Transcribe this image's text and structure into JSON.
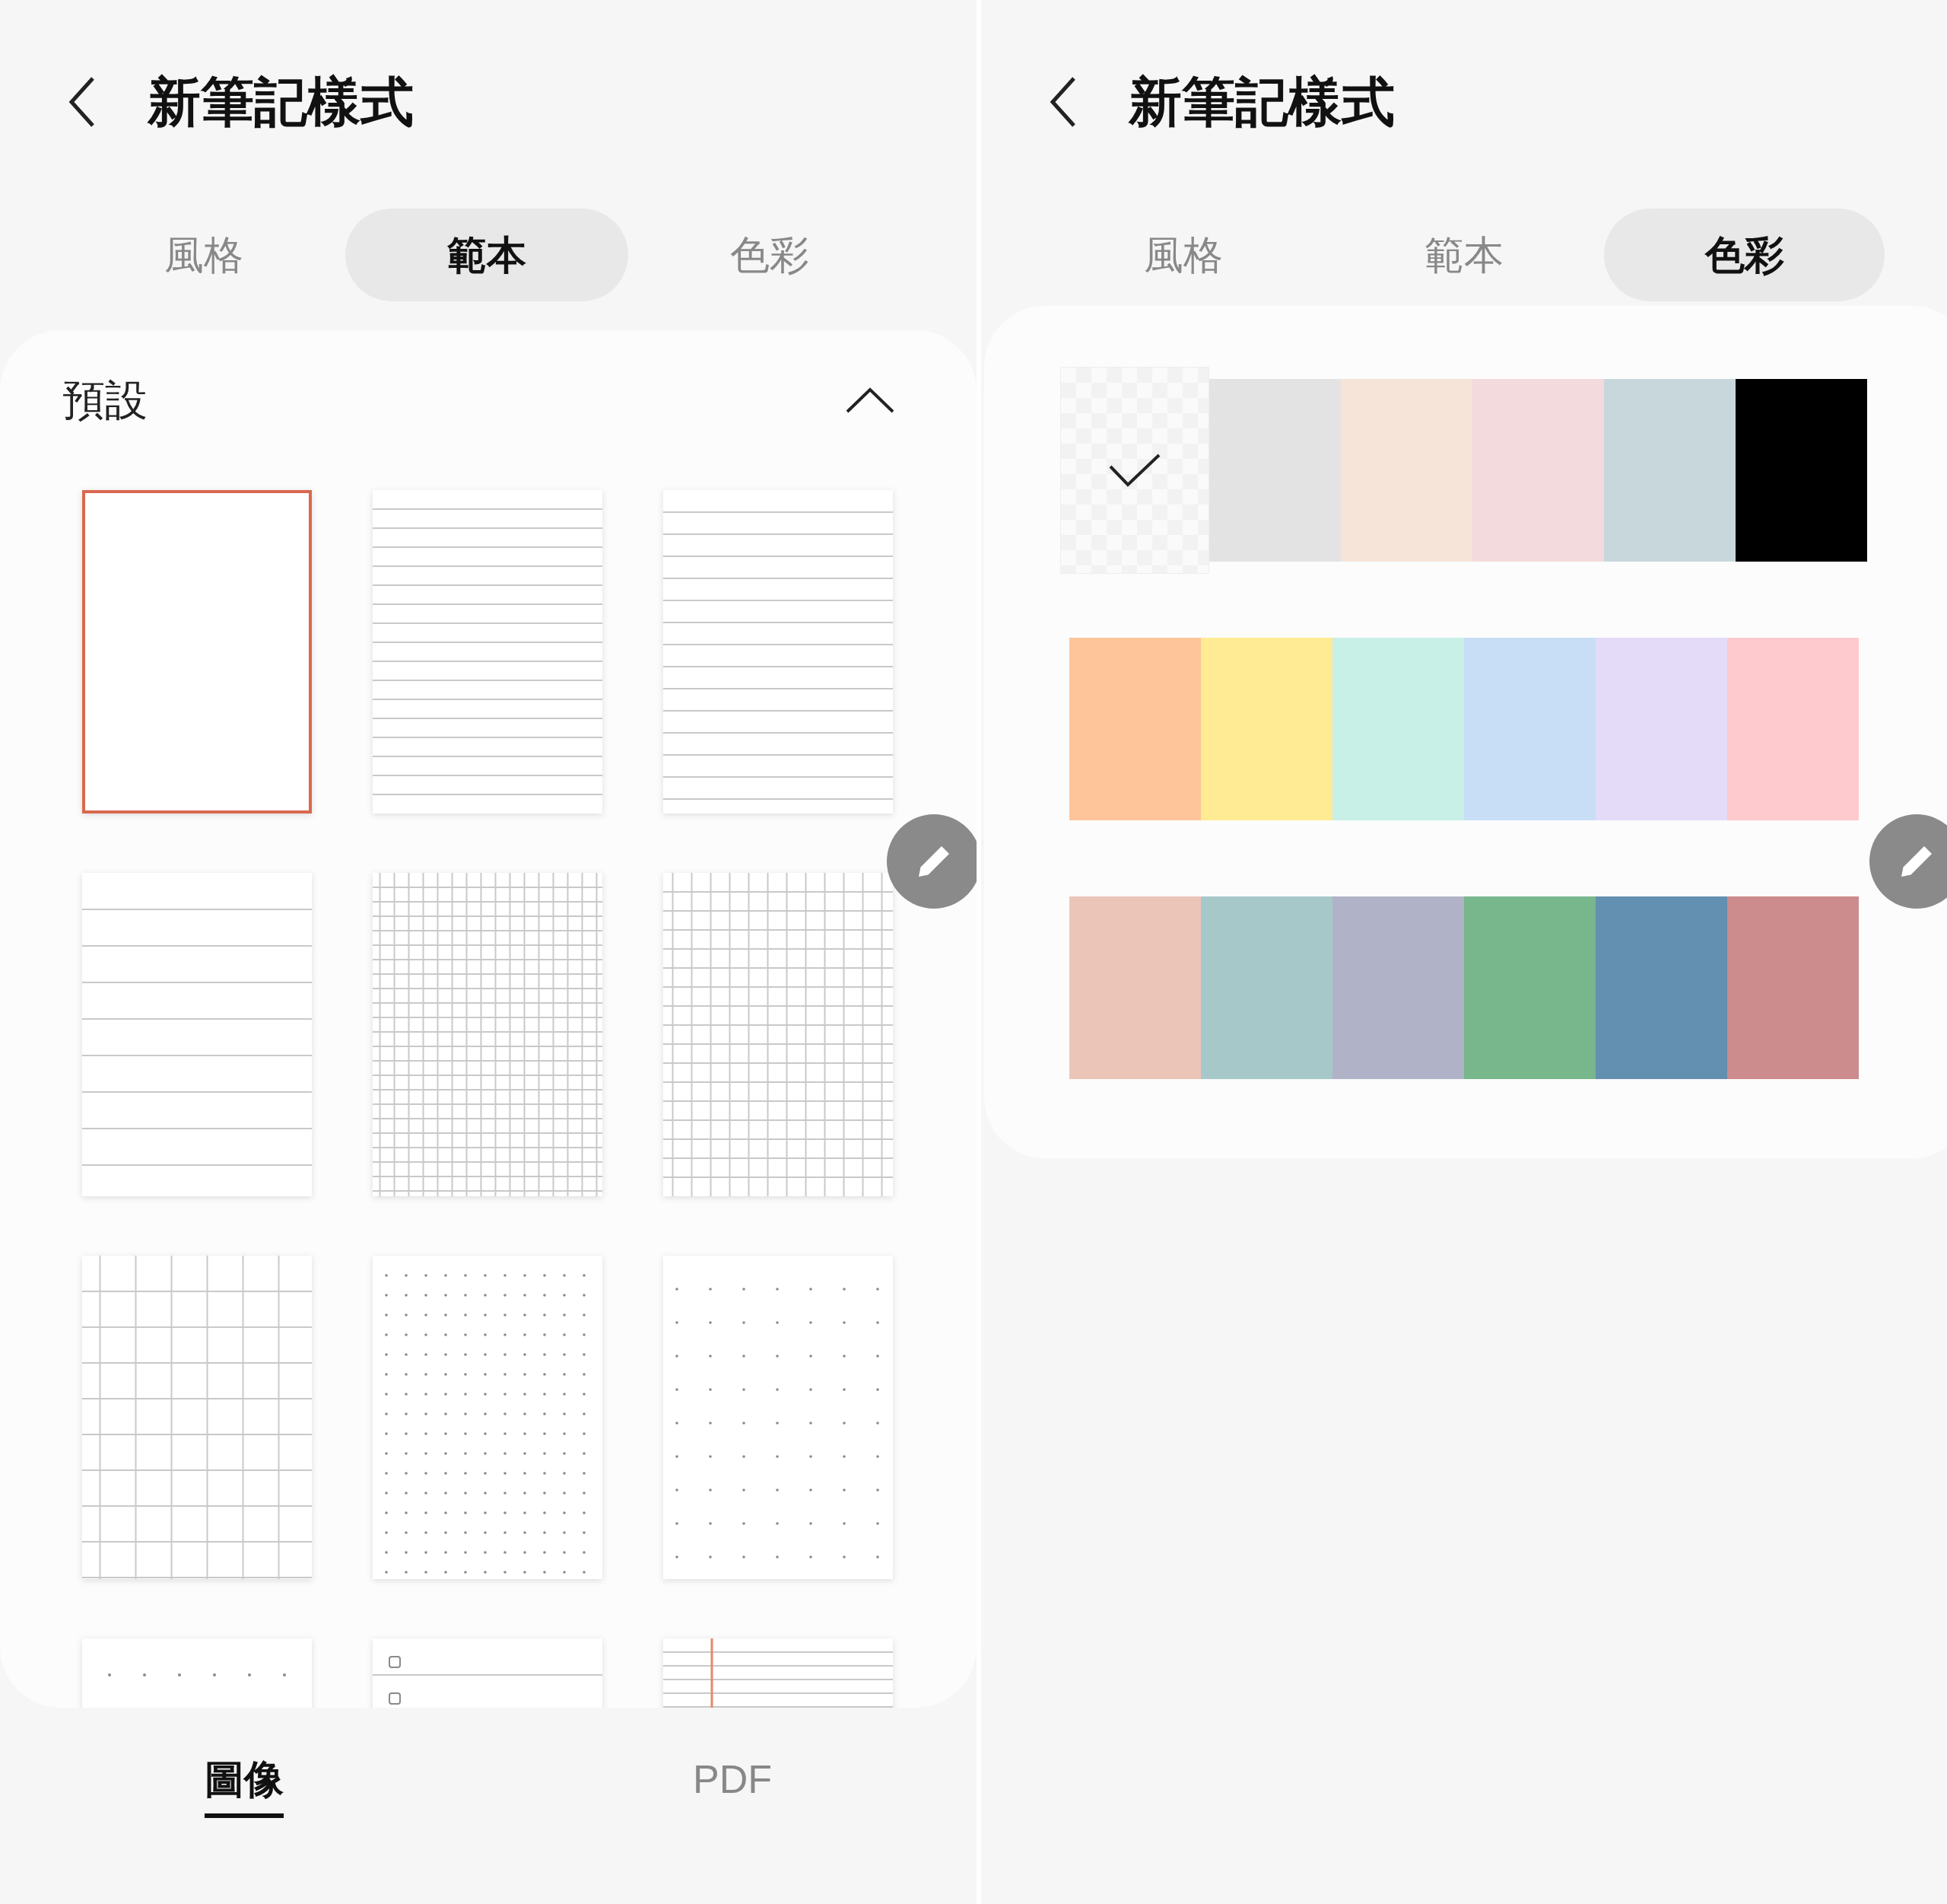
{
  "panels": [
    {
      "title": "新筆記樣式",
      "tabs": [
        {
          "label": "風格",
          "selected": false
        },
        {
          "label": "範本",
          "selected": true
        },
        {
          "label": "色彩",
          "selected": false
        }
      ],
      "section": {
        "title": "預設",
        "expanded": true,
        "templates": [
          {
            "kind": "blank",
            "selected": true
          },
          {
            "kind": "lines-narrow",
            "selected": false
          },
          {
            "kind": "lines-medium",
            "selected": false
          },
          {
            "kind": "lines-wide",
            "selected": false
          },
          {
            "kind": "grid-small",
            "selected": false
          },
          {
            "kind": "grid-medium",
            "selected": false
          },
          {
            "kind": "grid-large",
            "selected": false
          },
          {
            "kind": "dots-small",
            "selected": false
          },
          {
            "kind": "dots-large",
            "selected": false
          },
          {
            "kind": "dot-row",
            "selected": false
          },
          {
            "kind": "checklist",
            "selected": false
          },
          {
            "kind": "ruled-margin",
            "selected": false
          }
        ]
      },
      "bottom_tabs": [
        {
          "label": "圖像",
          "selected": true
        },
        {
          "label": "PDF",
          "selected": false
        }
      ]
    },
    {
      "title": "新筆記樣式",
      "tabs": [
        {
          "label": "風格",
          "selected": false
        },
        {
          "label": "範本",
          "selected": false
        },
        {
          "label": "色彩",
          "selected": true
        }
      ],
      "swatch_rows": [
        {
          "swatches": [
            {
              "kind": "transparent",
              "selected": true
            },
            {
              "kind": "solid",
              "color": "#e3e3e3",
              "selected": false
            },
            {
              "kind": "solid",
              "color": "#f6e4d8",
              "selected": false
            },
            {
              "kind": "solid",
              "color": "#f3dadc",
              "selected": false
            },
            {
              "kind": "solid",
              "color": "#c8d7dc",
              "selected": false
            },
            {
              "kind": "solid",
              "color": "#000000",
              "selected": false
            }
          ]
        },
        {
          "swatches": [
            {
              "kind": "solid",
              "color": "#fec59b",
              "selected": false
            },
            {
              "kind": "solid",
              "color": "#feeb94",
              "selected": false
            },
            {
              "kind": "solid",
              "color": "#c8f0e6",
              "selected": false
            },
            {
              "kind": "solid",
              "color": "#c8def6",
              "selected": false
            },
            {
              "kind": "solid",
              "color": "#e4dbf8",
              "selected": false
            },
            {
              "kind": "solid",
              "color": "#fecacd",
              "selected": false
            }
          ]
        },
        {
          "swatches": [
            {
              "kind": "solid",
              "color": "#ecc5b9",
              "selected": false
            },
            {
              "kind": "solid",
              "color": "#a7c8c9",
              "selected": false
            },
            {
              "kind": "solid",
              "color": "#b0b3c7",
              "selected": false
            },
            {
              "kind": "solid",
              "color": "#78b68c",
              "selected": false
            },
            {
              "kind": "solid",
              "color": "#6390b0",
              "selected": false
            },
            {
              "kind": "solid",
              "color": "#cc8b8c",
              "selected": false
            }
          ]
        }
      ]
    }
  ]
}
